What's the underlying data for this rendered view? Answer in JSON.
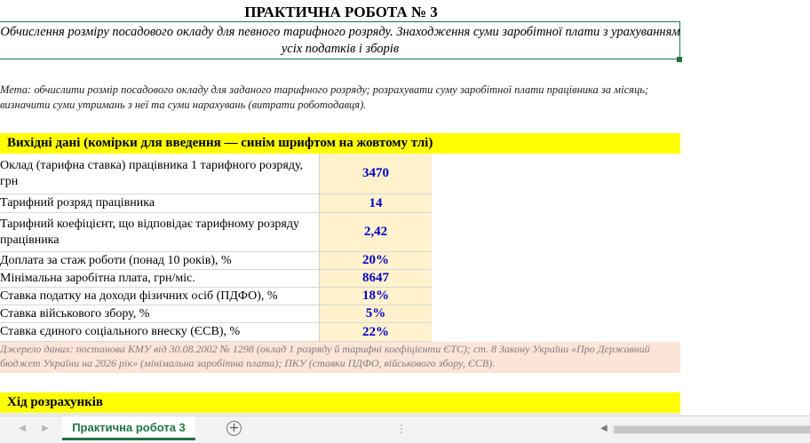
{
  "title": "ПРАКТИЧНА РОБОТА № 3",
  "subtitle": "Обчислення розміру посадового окладу для певного тарифного розряду. Знаходження суми заробітної плати з урахуванням усіх податків і зборів",
  "goal": "Мета: обчислити розмір посадового окладу для заданого тарифного розряду; розрахувати суму заробітної плати працівника за місяць; визначити суми утримань з неї та суми нарахувань (витрати роботодавця).",
  "inputs_header": "Вихідні дані (комірки для введення — синім шрифтом на жовтому тлі)",
  "rows": [
    {
      "label": "Оклад (тарифна ставка) працівника 1 тарифного розряду, грн",
      "value": "3470"
    },
    {
      "label": "Тарифний розряд працівника",
      "value": "14"
    },
    {
      "label": "Тарифний коефіцієнт, що відповідає тарифному розряду працівника",
      "value": "2,42"
    },
    {
      "label": "Доплата за стаж роботи (понад 10 років), %",
      "value": "20%"
    },
    {
      "label": "Мінімальна заробітна плата, грн/міс.",
      "value": "8647"
    },
    {
      "label": "Ставка податку на доходи фізичних осіб (ПДФО), %",
      "value": "18%"
    },
    {
      "label": "Ставка військового збору, %",
      "value": "5%"
    },
    {
      "label": "Ставка єдиного соціального внеску (ЄСВ), %",
      "value": "22%"
    }
  ],
  "source_note": "Джерело даних: постанова КМУ від 30.08.2002 № 1298 (оклад 1 розряду й тарифні коефіцієнти ЄТС); ст. 8 Закону України «Про Державний бюджет України на 2026 рік» (мінімальна заробітна плата); ПКУ (ставки ПДФО, військового збору, ЄСВ).",
  "calc_header": "Хід розрахунків",
  "sheet_tab": "Практична робота 3",
  "add_sheet": "+",
  "dots": "⋮",
  "colors": {
    "accent": "#217346",
    "input_bg": "#fff2cc",
    "input_text": "#0000cc",
    "band": "#ffff00",
    "note_bg": "#fce4d6"
  },
  "icons": {
    "scroll_prev": "chevron-left-icon",
    "scroll_next": "chevron-right-icon",
    "add": "plus-circle-icon"
  }
}
